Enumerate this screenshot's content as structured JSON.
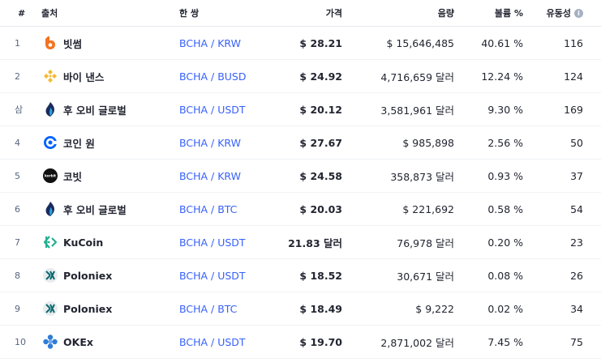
{
  "header": {
    "num": "#",
    "source": "출처",
    "pair": "한 쌍",
    "price": "가격",
    "volume": "음량",
    "share": "볼륨 %",
    "liquidity": "유동성",
    "info_icon": "info-icon"
  },
  "rows": [
    {
      "num": "1",
      "exchange": "빗썸",
      "icon": "bithumb-logo-icon",
      "pair": "BCHA / KRW",
      "price": "$ 28.21",
      "volume": "$ 15,646,485",
      "share": "40.61 %",
      "liquidity": "116"
    },
    {
      "num": "2",
      "exchange": "바이 낸스",
      "icon": "binance-logo-icon",
      "pair": "BCHA / BUSD",
      "price": "$ 24.92",
      "volume": "4,716,659 달러",
      "share": "12.24 %",
      "liquidity": "124"
    },
    {
      "num": "삼",
      "exchange": "후 오비 글로벌",
      "icon": "huobi-logo-icon",
      "pair": "BCHA / USDT",
      "price": "$ 20.12",
      "volume": "3,581,961 달러",
      "share": "9.30 %",
      "liquidity": "169"
    },
    {
      "num": "4",
      "exchange": "코인 원",
      "icon": "coinone-logo-icon",
      "pair": "BCHA / KRW",
      "price": "$ 27.67",
      "volume": "$ 985,898",
      "share": "2.56 %",
      "liquidity": "50"
    },
    {
      "num": "5",
      "exchange": "코빗",
      "icon": "korbit-logo-icon",
      "pair": "BCHA / KRW",
      "price": "$ 24.58",
      "volume": "358,873 달러",
      "share": "0.93 %",
      "liquidity": "37"
    },
    {
      "num": "6",
      "exchange": "후 오비 글로벌",
      "icon": "huobi-logo-icon",
      "pair": "BCHA / BTC",
      "price": "$ 20.03",
      "volume": "$ 221,692",
      "share": "0.58 %",
      "liquidity": "54"
    },
    {
      "num": "7",
      "exchange": "KuCoin",
      "icon": "kucoin-logo-icon",
      "pair": "BCHA / USDT",
      "price": "21.83 달러",
      "volume": "76,978 달러",
      "share": "0.20 %",
      "liquidity": "23"
    },
    {
      "num": "8",
      "exchange": "Poloniex",
      "icon": "poloniex-logo-icon",
      "pair": "BCHA / USDT",
      "price": "$ 18.52",
      "volume": "30,671 달러",
      "share": "0.08 %",
      "liquidity": "26"
    },
    {
      "num": "9",
      "exchange": "Poloniex",
      "icon": "poloniex-logo-icon",
      "pair": "BCHA / BTC",
      "price": "$ 18.49",
      "volume": "$ 9,222",
      "share": "0.02 %",
      "liquidity": "34"
    },
    {
      "num": "10",
      "exchange": "OKEx",
      "icon": "okex-logo-icon",
      "pair": "BCHA / USDT",
      "price": "$ 19.70",
      "volume": "2,871,002 달러",
      "share": "7.45 %",
      "liquidity": "75"
    }
  ],
  "colors": {
    "link": "#3861fb",
    "text": "#222531",
    "muted": "#58667e",
    "divider": "#eff2f5",
    "bithumb": "#f37321",
    "binance": "#f3ba2f",
    "huobi": "#1a2b5f",
    "coinone": "#0062ff",
    "kucoin": "#23af91",
    "okex": "#2f7dd6"
  }
}
